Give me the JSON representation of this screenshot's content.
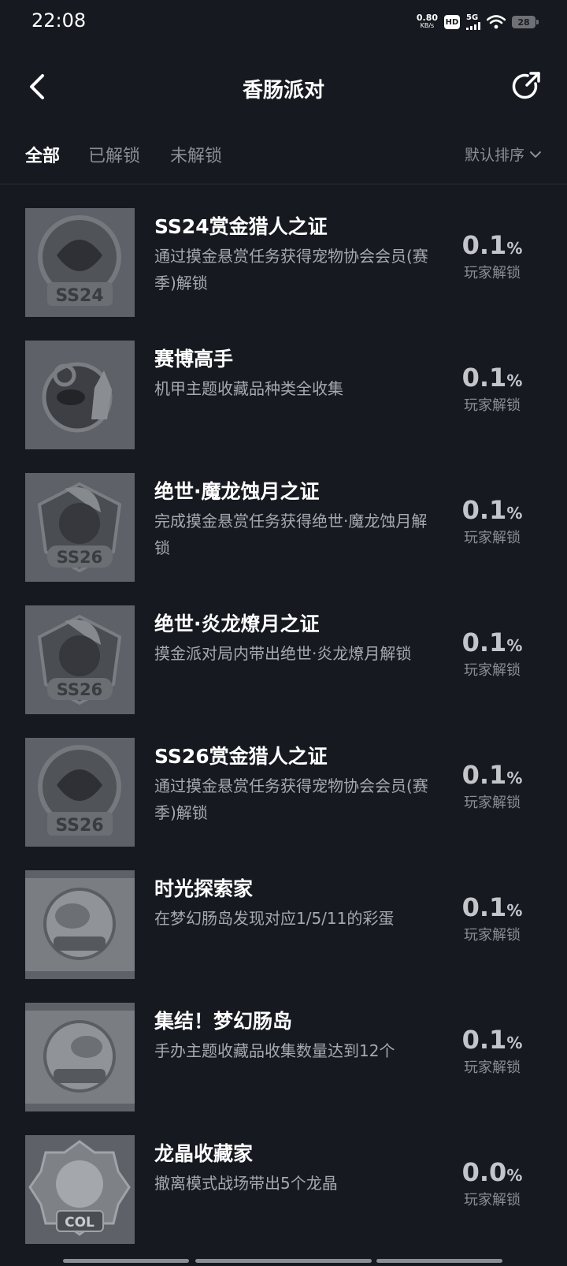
{
  "status_bar": {
    "time": "22:08",
    "net_speed_value": "0.80",
    "net_speed_unit": "KB/s",
    "hd_label": "HD",
    "network": "5G",
    "battery": "28"
  },
  "header": {
    "title": "香肠派对",
    "back_icon": "back-arrow-icon",
    "share_icon": "share-icon"
  },
  "tabs": [
    {
      "label": "全部",
      "active": true
    },
    {
      "label": "已解锁",
      "active": false
    },
    {
      "label": "未解锁",
      "active": false
    }
  ],
  "sort": {
    "label": "默认排序"
  },
  "achievements": [
    {
      "name": "SS24赏金猎人之证",
      "desc": "通过摸金悬赏任务获得宠物协会会员(赛季)解锁",
      "pct": "0.1",
      "unit": "%",
      "stat_label": "玩家解锁",
      "badge": "SS24"
    },
    {
      "name": "赛博高手",
      "desc": "机甲主题收藏品种类全收集",
      "pct": "0.1",
      "unit": "%",
      "stat_label": "玩家解锁",
      "badge": ""
    },
    {
      "name": "绝世·魔龙蚀月之证",
      "desc": "完成摸金悬赏任务获得绝世·魔龙蚀月解锁",
      "pct": "0.1",
      "unit": "%",
      "stat_label": "玩家解锁",
      "badge": "SS26"
    },
    {
      "name": "绝世·炎龙燎月之证",
      "desc": "摸金派对局内带出绝世·炎龙燎月解锁",
      "pct": "0.1",
      "unit": "%",
      "stat_label": "玩家解锁",
      "badge": "SS26"
    },
    {
      "name": "SS26赏金猎人之证",
      "desc": "通过摸金悬赏任务获得宠物协会会员(赛季)解锁",
      "pct": "0.1",
      "unit": "%",
      "stat_label": "玩家解锁",
      "badge": "SS26"
    },
    {
      "name": "时光探索家",
      "desc": "在梦幻肠岛发现对应1/5/11的彩蛋",
      "pct": "0.1",
      "unit": "%",
      "stat_label": "玩家解锁",
      "badge": ""
    },
    {
      "name": "集结！梦幻肠岛",
      "desc": "手办主题收藏品收集数量达到12个",
      "pct": "0.1",
      "unit": "%",
      "stat_label": "玩家解锁",
      "badge": ""
    },
    {
      "name": "龙晶收藏家",
      "desc": "撤离模式战场带出5个龙晶",
      "pct": "0.0",
      "unit": "%",
      "stat_label": "玩家解锁",
      "badge": "COL"
    }
  ],
  "colors": {
    "background": "#16191f",
    "thumb_bg": "#5e6167",
    "muted": "#8b8e95"
  }
}
